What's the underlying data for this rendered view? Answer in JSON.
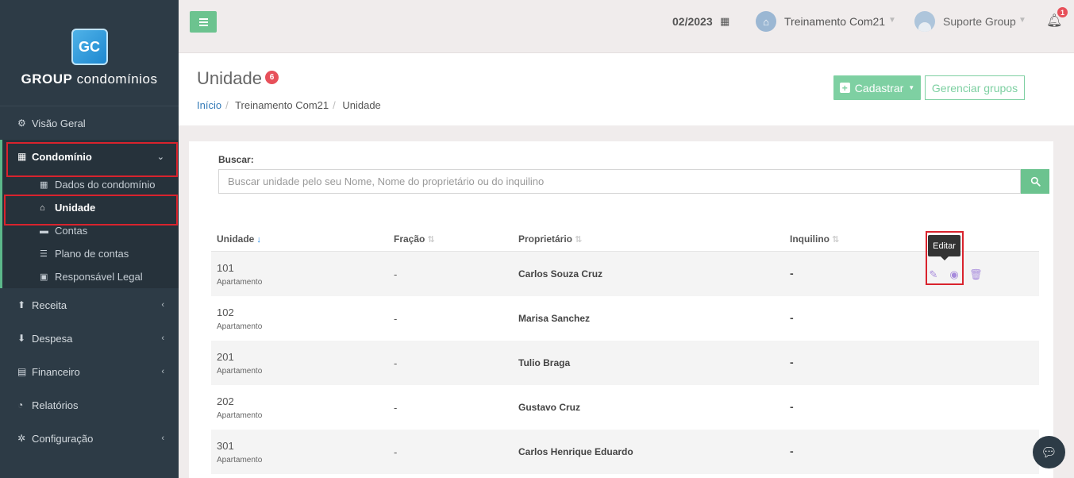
{
  "brand": {
    "logo_initials": "GC",
    "name_bold": "GROUP",
    "name_regular": "condomínios"
  },
  "sidebar": {
    "items": [
      {
        "label": "Visão Geral",
        "icon": "gauge-icon"
      },
      {
        "label": "Condomínio",
        "icon": "building-icon",
        "active": true
      },
      {
        "label": "Receita",
        "icon": "arrow-circle-up-icon"
      },
      {
        "label": "Despesa",
        "icon": "arrow-circle-down-icon"
      },
      {
        "label": "Financeiro",
        "icon": "calculator-icon"
      },
      {
        "label": "Relatórios",
        "icon": "pie-chart-icon"
      },
      {
        "label": "Configuração",
        "icon": "gear-icon"
      }
    ],
    "submenu": [
      {
        "label": "Dados do condomínio",
        "icon": "building-icon"
      },
      {
        "label": "Unidade",
        "icon": "home-icon",
        "active": true
      },
      {
        "label": "Contas",
        "icon": "credit-card-icon"
      },
      {
        "label": "Plano de contas",
        "icon": "list-icon"
      },
      {
        "label": "Responsável Legal",
        "icon": "id-card-icon"
      }
    ]
  },
  "topbar": {
    "period": "02/2023",
    "organization": "Treinamento Com21",
    "user": "Suporte Group",
    "notification_count": "1"
  },
  "page": {
    "title": "Unidade",
    "count_badge": "6",
    "breadcrumb": [
      "Início",
      "Treinamento Com21",
      "Unidade"
    ],
    "cadastrar_label": "Cadastrar",
    "gerenciar_label": "Gerenciar grupos"
  },
  "search": {
    "label": "Buscar:",
    "placeholder": "Buscar unidade pelo seu Nome, Nome do proprietário ou do inquilino"
  },
  "table": {
    "headers": [
      "Unidade",
      "Fração",
      "Proprietário",
      "Inquilino"
    ],
    "rows": [
      {
        "unit": "101",
        "type": "Apartamento",
        "fraction": "-",
        "owner": "Carlos Souza Cruz",
        "tenant": "-"
      },
      {
        "unit": "102",
        "type": "Apartamento",
        "fraction": "-",
        "owner": "Marisa Sanchez",
        "tenant": "-"
      },
      {
        "unit": "201",
        "type": "Apartamento",
        "fraction": "-",
        "owner": "Tulio Braga",
        "tenant": "-"
      },
      {
        "unit": "202",
        "type": "Apartamento",
        "fraction": "-",
        "owner": "Gustavo Cruz",
        "tenant": "-"
      },
      {
        "unit": "301",
        "type": "Apartamento",
        "fraction": "-",
        "owner": "Carlos Henrique Eduardo",
        "tenant": "-"
      }
    ]
  },
  "tooltip": "Editar",
  "colors": {
    "sidebar_bg": "#2d3b46",
    "accent_green": "#6cc38f",
    "highlight_red": "#d9232d",
    "action_purple": "#a78bdc",
    "badge_red": "#e7505a"
  }
}
